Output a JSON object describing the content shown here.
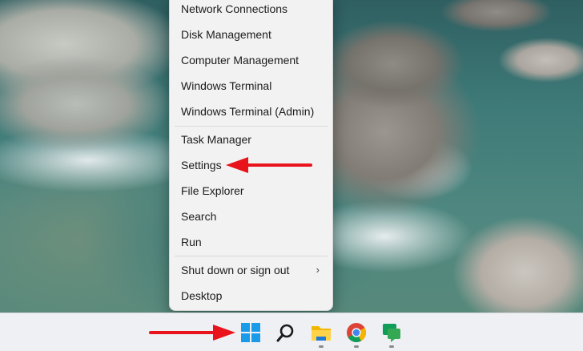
{
  "context_menu": {
    "items": [
      {
        "label": "Network Connections"
      },
      {
        "label": "Disk Management"
      },
      {
        "label": "Computer Management"
      },
      {
        "label": "Windows Terminal"
      },
      {
        "label": "Windows Terminal (Admin)"
      },
      {
        "label": "Task Manager"
      },
      {
        "label": "Settings"
      },
      {
        "label": "File Explorer"
      },
      {
        "label": "Search"
      },
      {
        "label": "Run"
      },
      {
        "label": "Shut down or sign out",
        "submenu_icon": "chevron-right-icon"
      },
      {
        "label": "Desktop"
      }
    ]
  },
  "taskbar": {
    "icons": [
      {
        "name": "start-windows-icon"
      },
      {
        "name": "search-icon"
      },
      {
        "name": "file-explorer-folder-icon"
      },
      {
        "name": "chrome-icon"
      },
      {
        "name": "google-chat-icon"
      }
    ]
  },
  "annotations": {
    "arrow_color": "#e8131b",
    "settings_arrow": "red-arrow-pointing-left-icon",
    "start_arrow": "red-arrow-pointing-right-icon"
  }
}
